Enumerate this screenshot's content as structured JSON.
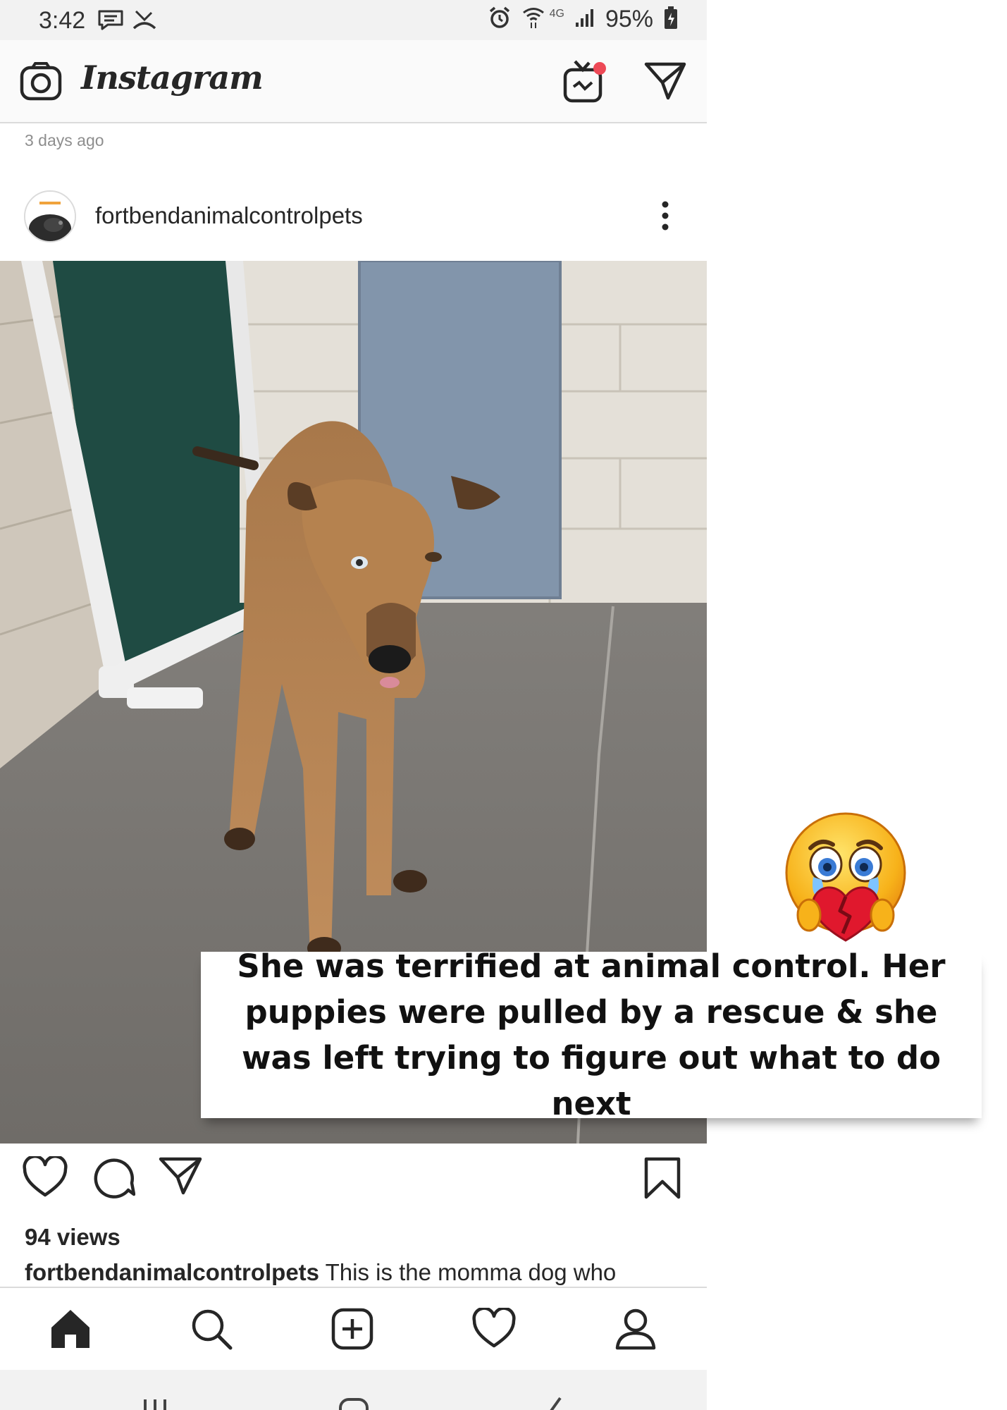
{
  "status_bar": {
    "time": "3:42",
    "network": "4G",
    "battery": "95%"
  },
  "header": {
    "app_name": "Instagram"
  },
  "feed": {
    "time_ago": "3 days ago"
  },
  "post": {
    "username": "fortbendanimalcontrolpets",
    "views": "94 views",
    "caption_user": "fortbendanimalcontrolpets",
    "caption_text": "This is the momma dog who"
  },
  "overlay": {
    "caption": "She was terrified at animal control. Her puppies were pulled by a rescue & she was left trying to figure out what to do next"
  },
  "colors": {
    "ig_text": "#262626",
    "ig_gray": "#8e8e8e",
    "notification_dot": "#ed4956"
  },
  "icons": [
    "message-icon",
    "missed-call-icon",
    "alarm-icon",
    "wifi-icon",
    "signal-icon",
    "battery-icon",
    "camera-icon",
    "igtv-icon",
    "direct-message-icon",
    "more-options-icon",
    "heart-icon",
    "comment-icon",
    "share-icon",
    "bookmark-icon",
    "home-icon",
    "search-icon",
    "add-post-icon",
    "activity-icon",
    "profile-icon",
    "crying-broken-heart-emoji"
  ]
}
